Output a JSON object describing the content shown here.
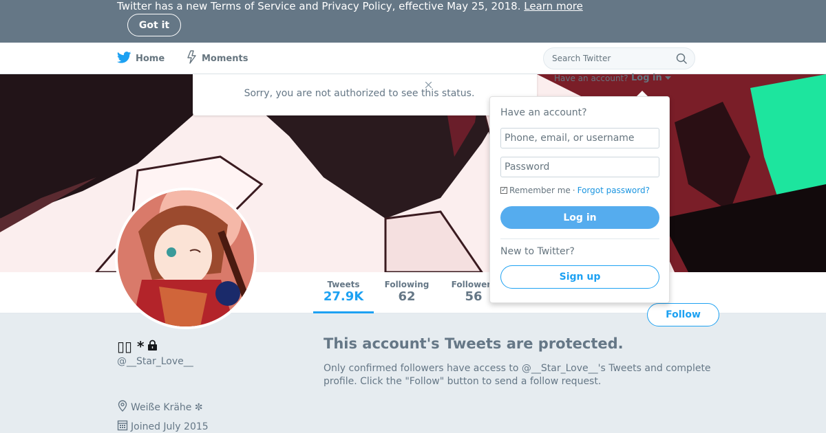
{
  "banner": {
    "message": "Twitter has a new Terms of Service and Privacy Policy, effective May 25, 2018.",
    "learn_more": "Learn more",
    "got_it": "Got it"
  },
  "nav": {
    "home": "Home",
    "moments": "Moments",
    "search_placeholder": "Search Twitter",
    "have_account": "Have an account?",
    "login_toggle": "Log in"
  },
  "status_notice": "Sorry, you are not authorized to see this status.",
  "login_dropdown": {
    "heading": "Have an account?",
    "username_placeholder": "Phone, email, or username",
    "password_placeholder": "Password",
    "remember_me": "Remember me",
    "separator": "·",
    "forgot_password": "Forgot password?",
    "login_button": "Log in",
    "new_to_twitter": "New to Twitter?",
    "signup_button": "Sign up"
  },
  "profile_nav": {
    "stats": [
      {
        "label": "Tweets",
        "value": "27.9K"
      },
      {
        "label": "Following",
        "value": "62"
      },
      {
        "label": "Followers",
        "value": "56"
      }
    ],
    "follow_button": "Follow"
  },
  "profile": {
    "name": "▯▯ *",
    "handle": "@__Star_Love__",
    "location": "Weiße Krähe ✼",
    "joined": "Joined July 2015"
  },
  "protected": {
    "title": "This account's Tweets are protected.",
    "body": "Only confirmed followers have access to @__Star_Love__'s Tweets and complete profile. Click the \"Follow\" button to send a follow request."
  },
  "colors": {
    "banner_bg": "#657786",
    "accent": "#1da1f2",
    "page_bg": "#e6ecf0"
  }
}
